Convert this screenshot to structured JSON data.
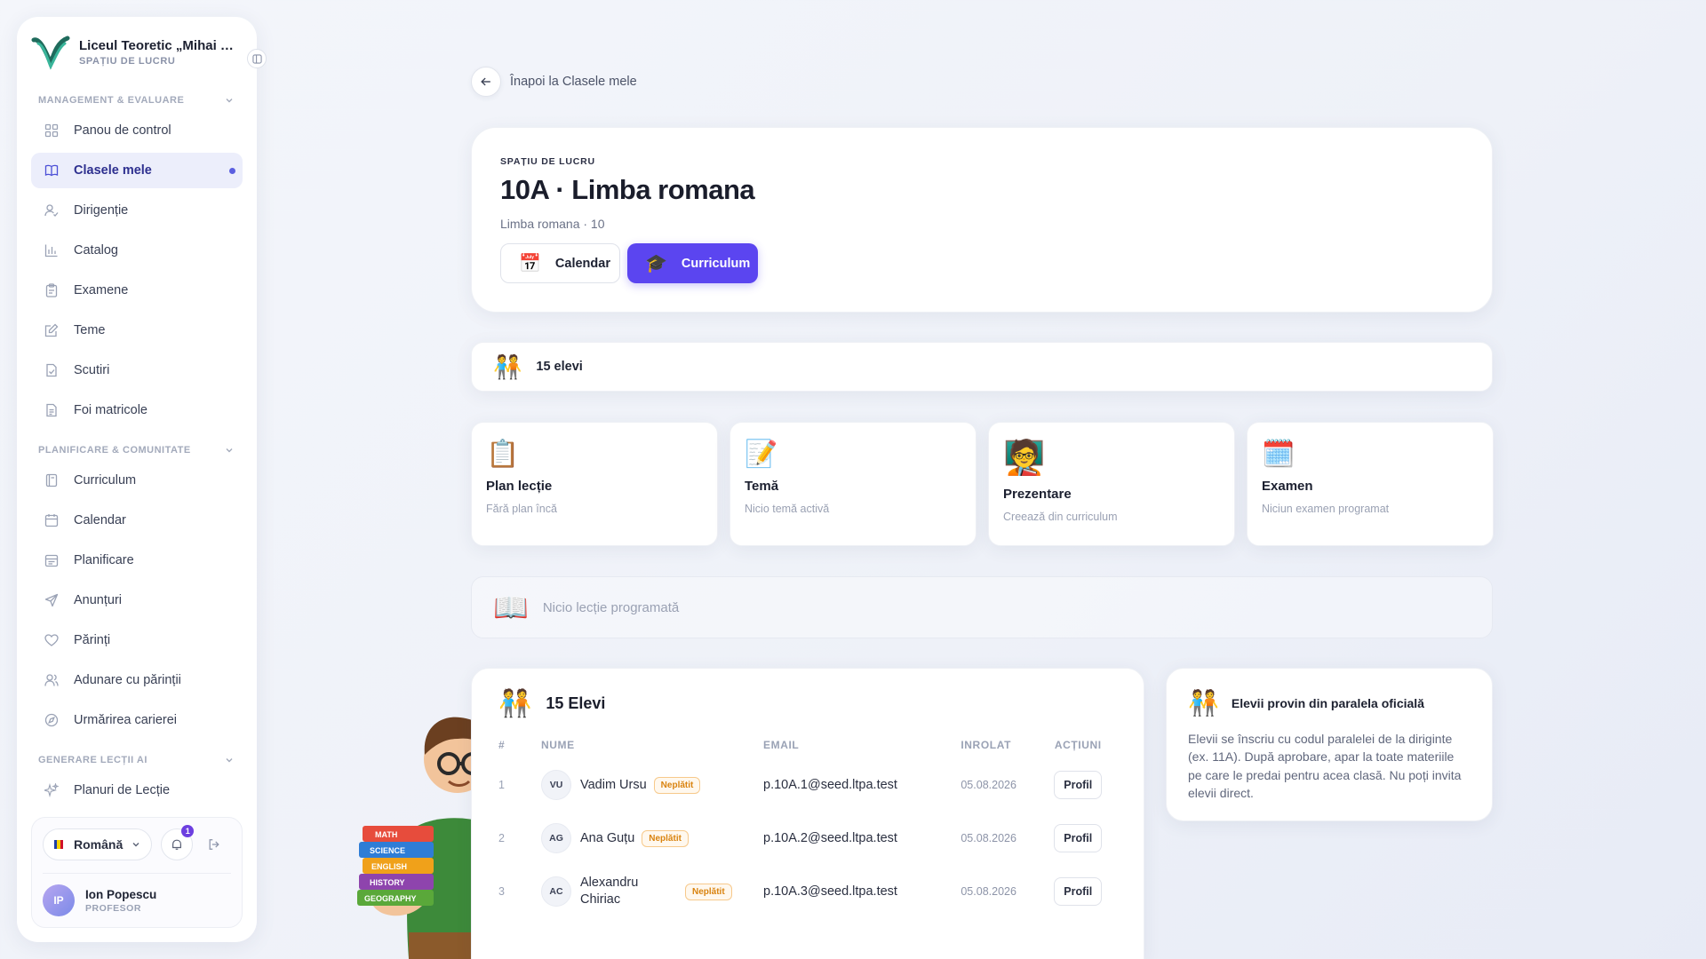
{
  "sidebar": {
    "school_name": "Liceul Teoretic „Mihai Emi…",
    "workspace_label": "SPAȚIU DE LUCRU",
    "sections": [
      {
        "title": "MANAGEMENT & EVALUARE",
        "items": [
          {
            "label": "Panou de control",
            "icon": "grid-icon"
          },
          {
            "label": "Clasele mele",
            "icon": "book-icon",
            "active": true
          },
          {
            "label": "Dirigenție",
            "icon": "user-check-icon"
          },
          {
            "label": "Catalog",
            "icon": "bar-chart-icon"
          },
          {
            "label": "Examene",
            "icon": "clipboard-icon"
          },
          {
            "label": "Teme",
            "icon": "edit-icon"
          },
          {
            "label": "Scutiri",
            "icon": "file-check-icon"
          },
          {
            "label": "Foi matricole",
            "icon": "file-text-icon"
          }
        ]
      },
      {
        "title": "PLANIFICARE & COMUNITATE",
        "items": [
          {
            "label": "Curriculum",
            "icon": "book-open-icon"
          },
          {
            "label": "Calendar",
            "icon": "calendar-icon"
          },
          {
            "label": "Planificare",
            "icon": "calendar-list-icon"
          },
          {
            "label": "Anunțuri",
            "icon": "send-icon"
          },
          {
            "label": "Părinți",
            "icon": "heart-icon"
          },
          {
            "label": "Adunare cu părinții",
            "icon": "users-icon"
          },
          {
            "label": "Urmărirea carierei",
            "icon": "compass-icon"
          }
        ]
      },
      {
        "title": "GENERARE LECȚII AI",
        "items": [
          {
            "label": "Planuri de Lecție",
            "icon": "sparkles-icon"
          }
        ]
      }
    ],
    "footer": {
      "language": "Română",
      "notifications_count": "1",
      "user_initials": "IP",
      "user_name": "Ion Popescu",
      "user_role": "PROFESOR"
    }
  },
  "back_link": "Înapoi la Clasele mele",
  "hero": {
    "eyebrow": "SPAȚIU DE LUCRU",
    "title": "10A · Limba romana",
    "subtitle": "Limba romana · 10",
    "buttons": [
      {
        "label": "Calendar",
        "icon": "📅"
      },
      {
        "label": "Curriculum",
        "icon": "🎓"
      }
    ]
  },
  "count_bar": {
    "icon": "🧑‍🤝‍🧑",
    "label": "15 elevi"
  },
  "tiles": [
    {
      "icon": "📋",
      "title": "Plan lecție",
      "subtitle": "Fără plan încă"
    },
    {
      "icon": "📝",
      "title": "Temă",
      "subtitle": "Nicio temă activă"
    },
    {
      "icon": "🧑‍🏫",
      "title": "Prezentare",
      "subtitle": "Creează din curriculum"
    },
    {
      "icon": "🗓️",
      "title": "Examen",
      "subtitle": "Niciun examen programat"
    }
  ],
  "no_lesson": {
    "icon": "📖",
    "label": "Nicio lecție programată"
  },
  "students": {
    "title": "15 Elevi",
    "columns": [
      "#",
      "NUME",
      "EMAIL",
      "INROLAT",
      "ACȚIUNI"
    ],
    "rows": [
      {
        "idx": "1",
        "initials": "VU",
        "name": "Vadim Ursu",
        "status": "Neplătit",
        "email": "p.10A.1@seed.ltpa.test",
        "enrolled": "05.08.2026",
        "action": "Profil"
      },
      {
        "idx": "2",
        "initials": "AG",
        "name": "Ana Guțu",
        "status": "Neplătit",
        "email": "p.10A.2@seed.ltpa.test",
        "enrolled": "05.08.2026",
        "action": "Profil"
      },
      {
        "idx": "3",
        "initials": "AC",
        "name": "Alexandru Chiriac",
        "status": "Neplătit",
        "email": "p.10A.3@seed.ltpa.test",
        "enrolled": "05.08.2026",
        "action": "Profil"
      }
    ]
  },
  "info": {
    "title": "Elevii provin din paralela oficială",
    "text": "Elevii se înscriu cu codul paralelei de la diriginte (ex. 11A). După aprobare, apar la toate materiile pe care le predai pentru acea clasă. Nu poți invita elevii direct."
  },
  "mascot_books": [
    "MATH",
    "SCIENCE",
    "ENGLISH",
    "HISTORY",
    "GEOGRAPHY"
  ],
  "colors": {
    "accent": "#5b45f0",
    "active_bg": "#eceefb",
    "unpaid": "#d9830f"
  }
}
